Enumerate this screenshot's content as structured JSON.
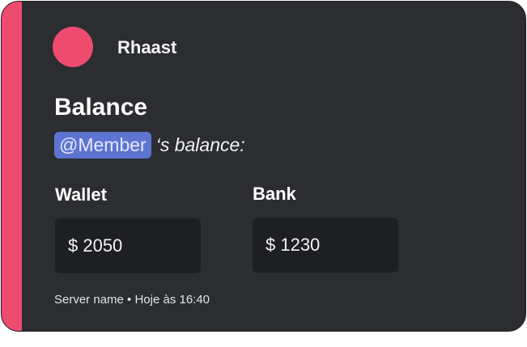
{
  "embed": {
    "author": "Rhaast",
    "title": "Balance",
    "mention": "@Member",
    "description_suffix": "‘s balance:",
    "accent_color": "#ee4c6f",
    "fields": [
      {
        "name": "Wallet",
        "value": "$ 2050"
      },
      {
        "name": "Bank",
        "value": "$ 1230"
      }
    ],
    "footer": "Server name • Hoje às 16:40"
  }
}
